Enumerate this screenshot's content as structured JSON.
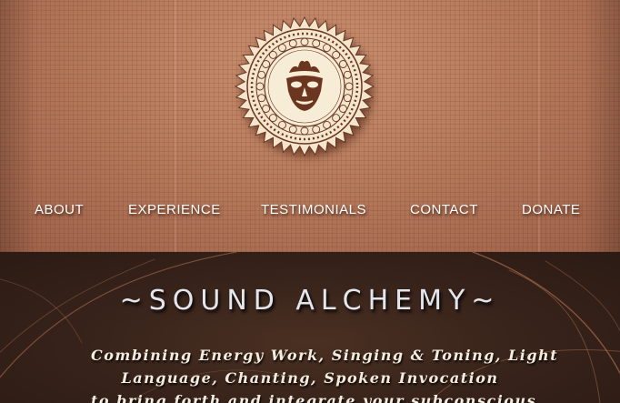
{
  "colors": {
    "header_bg": "#b77a5c",
    "hero_bg": "#36221a",
    "nav_text": "#ffffff",
    "title_text": "#e3e6ec",
    "logo_cream": "#f3e6cc",
    "logo_brown": "#6b3520"
  },
  "logo": {
    "icon": "mask-mandala-icon"
  },
  "nav": {
    "items": [
      {
        "label": "ABOUT"
      },
      {
        "label": "EXPERIENCE"
      },
      {
        "label": "TESTIMONIALS"
      },
      {
        "label": "CONTACT"
      },
      {
        "label": "DONATE"
      }
    ]
  },
  "hero": {
    "title": "~SOUND ALCHEMY~",
    "subtitle_lines": [
      "Combining Energy Work, Singing & Toning, Light",
      "Language, Chanting, Spoken Invocation",
      "to bring forth and integrate your subconscious"
    ]
  }
}
